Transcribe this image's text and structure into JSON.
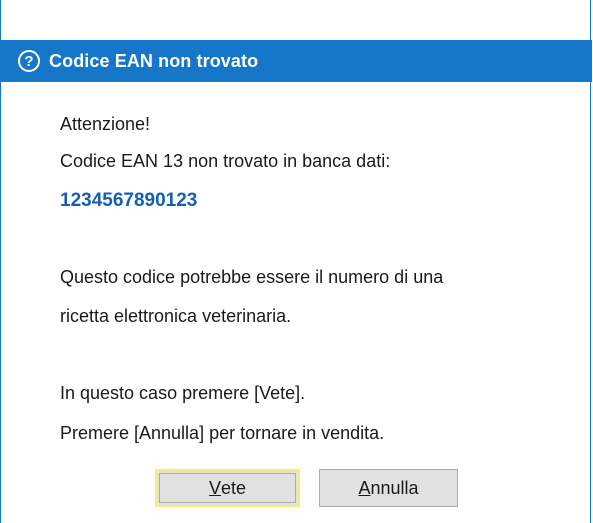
{
  "dialog": {
    "title": "Codice EAN non trovato",
    "title_icon": "question-circle-icon",
    "accent_color": "#1676c8",
    "code_color": "#1560b0"
  },
  "message": {
    "line1": "Attenzione!",
    "line2": "Codice EAN 13 non trovato in banca dati:",
    "code": "1234567890123",
    "line3": "Questo codice potrebbe essere il numero di una",
    "line4": "ricetta elettronica veterinaria.",
    "line5": "In questo caso premere [Vete].",
    "line6": "Premere [Annulla] per tornare in vendita."
  },
  "buttons": {
    "vete_mnemonic": "V",
    "vete_rest": "ete",
    "annulla_mnemonic": "A",
    "annulla_rest": "nnulla"
  }
}
